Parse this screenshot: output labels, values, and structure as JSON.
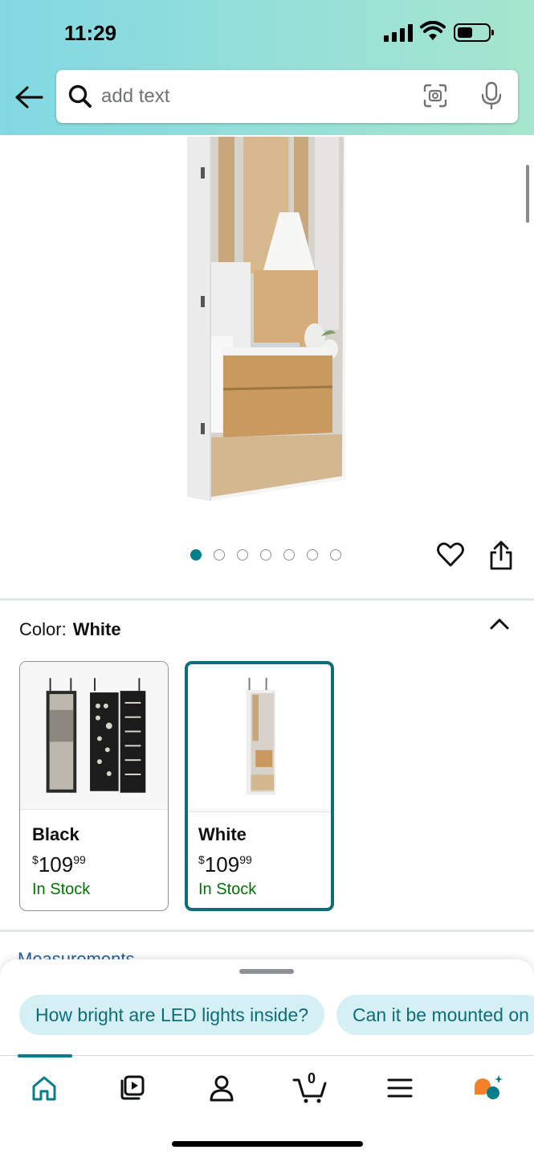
{
  "status_bar": {
    "time": "11:29"
  },
  "search": {
    "placeholder": "add text",
    "value": ""
  },
  "product_gallery": {
    "image_count": 7,
    "active_index": 0
  },
  "variant": {
    "label": "Color:",
    "selected": "White",
    "options": [
      {
        "name": "Black",
        "price_dollar": "$",
        "price_whole": "109",
        "price_cents": "99",
        "stock": "In Stock"
      },
      {
        "name": "White",
        "price_dollar": "$",
        "price_whole": "109",
        "price_cents": "99",
        "stock": "In Stock"
      }
    ]
  },
  "next_section_peek": "Measurements",
  "suggestions": [
    "How bright are LED lights inside?",
    "Can it be mounted on"
  ],
  "tabbar": {
    "items": [
      "home-icon",
      "video-icon",
      "account-icon",
      "cart-icon",
      "menu-icon",
      "rufus-icon"
    ],
    "cart_count": "0"
  },
  "colors": {
    "accent": "#067d8a",
    "in_stock": "#007600",
    "chip_bg": "#d5f0f4"
  }
}
